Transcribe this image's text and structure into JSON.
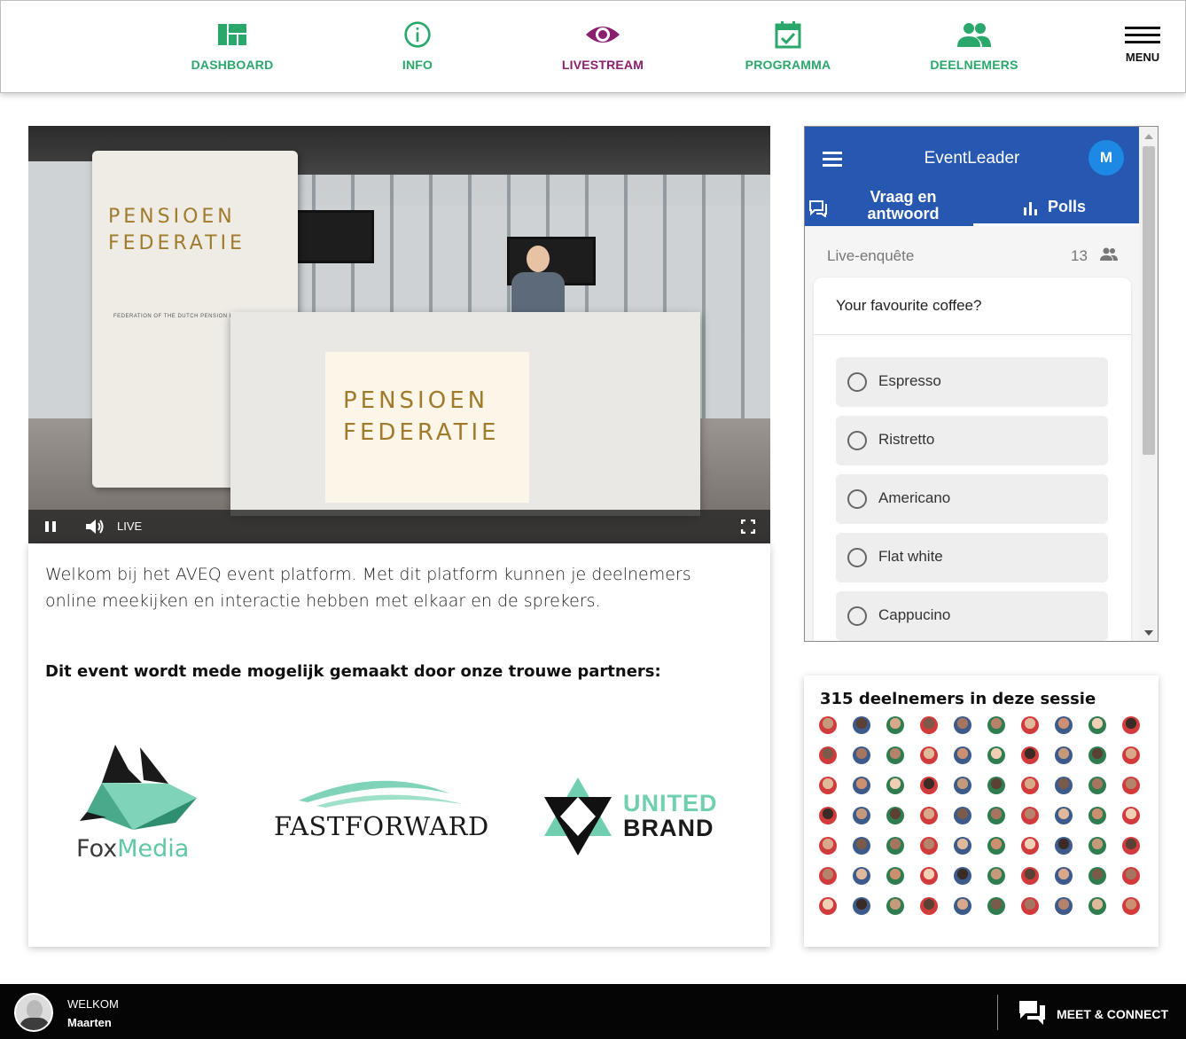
{
  "nav": {
    "items": [
      {
        "label": "DASHBOARD",
        "icon": "dashboard-icon",
        "color": "#2aa86b"
      },
      {
        "label": "INFO",
        "icon": "info-icon",
        "color": "#2aa86b"
      },
      {
        "label": "LIVESTREAM",
        "icon": "eye-icon",
        "color": "#8b1e6f",
        "active": true
      },
      {
        "label": "PROGRAMMA",
        "icon": "calendar-check-icon",
        "color": "#2aa86b"
      },
      {
        "label": "DEELNEMERS",
        "icon": "people-icon",
        "color": "#2aa86b"
      }
    ],
    "menu_label": "MENU"
  },
  "video": {
    "live_label": "LIVE",
    "brand_line1": "PENSIOEN",
    "brand_line2": "FEDERATIE",
    "brand_sub": "FEDERATION OF THE DUTCH PENSION FUNDS"
  },
  "content": {
    "intro": "Welkom bij het AVEQ event platform. Met dit platform kunnen je deelnemers online meekijken en interactie hebben met elkaar en de sprekers.",
    "partners_title": "Dit event wordt mede mogelijk gemaakt door onze trouwe partners:",
    "partners": {
      "foxmedia_a": "Fox",
      "foxmedia_b": "Media",
      "fastforward": "FASTFORWARD",
      "united": "UNITED",
      "brand": "BRAND"
    }
  },
  "widget": {
    "title": "EventLeader",
    "avatar_letter": "M",
    "tab_qa": "Vraag en antwoord",
    "tab_polls": "Polls",
    "poll_label": "Live-enquête",
    "poll_count": "13",
    "question": "Your favourite coffee?",
    "options": [
      "Espresso",
      "Ristretto",
      "Americano",
      "Flat white",
      "Cappucino"
    ]
  },
  "participants": {
    "title": "315 deelnemers in deze sessie"
  },
  "footer": {
    "welcome": "WELKOM",
    "name": "Maarten",
    "meet": "MEET & CONNECT"
  },
  "colors": {
    "accent_green": "#2aa86b",
    "accent_purple": "#8b1e6f",
    "widget_blue": "#2657b1"
  }
}
